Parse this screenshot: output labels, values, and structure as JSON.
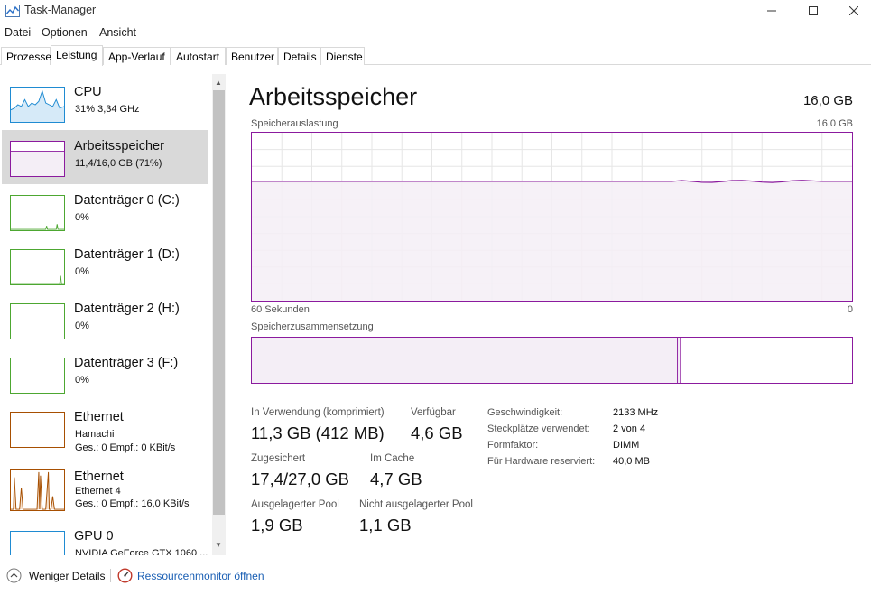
{
  "window": {
    "title": "Task-Manager"
  },
  "menu": [
    "Datei",
    "Optionen",
    "Ansicht"
  ],
  "tabs": [
    "Prozesse",
    "Leistung",
    "App-Verlauf",
    "Autostart",
    "Benutzer",
    "Details",
    "Dienste"
  ],
  "active_tab": "Leistung",
  "sidebar": {
    "items": [
      {
        "title": "CPU",
        "sub": "31% 3,34 GHz",
        "color": "#1f8bd2"
      },
      {
        "title": "Arbeitsspeicher",
        "sub": "11,4/16,0 GB (71%)",
        "color": "#8b1a9e"
      },
      {
        "title": "Datenträger 0 (C:)",
        "sub": "0%",
        "color": "#4da731"
      },
      {
        "title": "Datenträger 1 (D:)",
        "sub": "0%",
        "color": "#4da731"
      },
      {
        "title": "Datenträger 2 (H:)",
        "sub": "0%",
        "color": "#4da731"
      },
      {
        "title": "Datenträger 3 (F:)",
        "sub": "0%",
        "color": "#4da731"
      },
      {
        "title": "Ethernet",
        "sub": "Hamachi",
        "sub2": "Ges.: 0 Empf.: 0 KBit/s",
        "color": "#a74f01"
      },
      {
        "title": "Ethernet",
        "sub": "Ethernet 4",
        "sub2": "Ges.: 0 Empf.: 16,0 KBit/s",
        "color": "#a74f01"
      },
      {
        "title": "GPU 0",
        "sub": "NVIDIA GeForce GTX 1060 ...",
        "color": "#1f8bd2"
      }
    ]
  },
  "main": {
    "title": "Arbeitsspeicher",
    "total": "16,0 GB",
    "graph_label": "Speicherauslastung",
    "graph_max": "16,0 GB",
    "time_label": "60 Sekunden",
    "time_end": "0",
    "composition_label": "Speicherzusammensetzung",
    "usage_percent": 71
  },
  "stats": {
    "in_use_label": "In Verwendung (komprimiert)",
    "in_use_value": "11,3 GB (412 MB)",
    "available_label": "Verfügbar",
    "available_value": "4,6 GB",
    "committed_label": "Zugesichert",
    "committed_value": "17,4/27,0 GB",
    "cached_label": "Im Cache",
    "cached_value": "4,7 GB",
    "paged_label": "Ausgelagerter Pool",
    "paged_value": "1,9 GB",
    "nonpaged_label": "Nicht ausgelagerter Pool",
    "nonpaged_value": "1,1 GB"
  },
  "specs": [
    {
      "label": "Geschwindigkeit:",
      "value": "2133 MHz"
    },
    {
      "label": "Steckplätze verwendet:",
      "value": "2 von 4"
    },
    {
      "label": "Formfaktor:",
      "value": "DIMM"
    },
    {
      "label": "Für Hardware reserviert:",
      "value": "40,0 MB"
    }
  ],
  "footer": {
    "fewer_details": "Weniger Details",
    "resource_monitor": "Ressourcenmonitor öffnen"
  }
}
